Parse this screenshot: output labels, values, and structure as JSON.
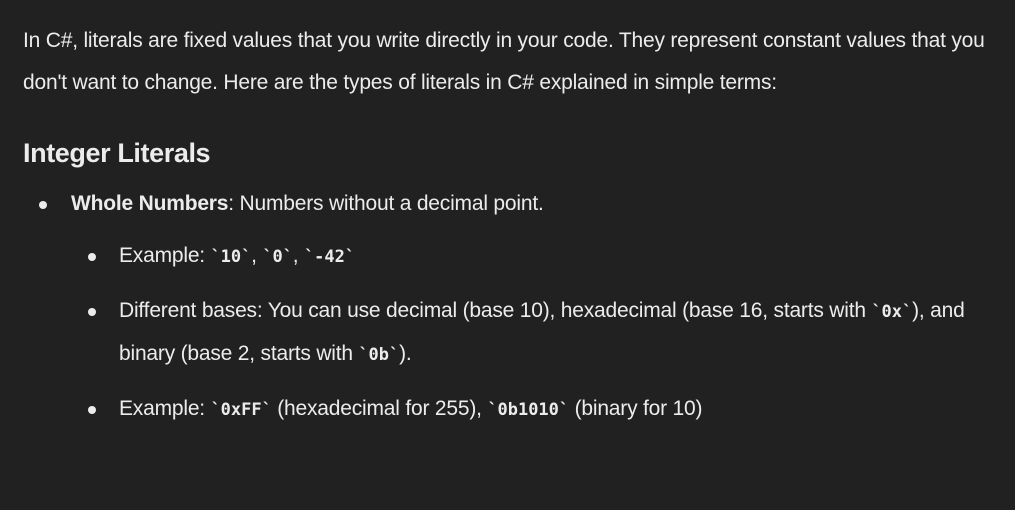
{
  "intro": "In C#, literals are fixed values that you write directly in your code. They represent constant values that you don't want to change. Here are the types of literals in C# explained in simple terms:",
  "section": {
    "heading": "Integer Literals",
    "item": {
      "term": "Whole Numbers",
      "desc": ": Numbers without a decimal point."
    },
    "subitems": {
      "example1": {
        "prefix": "Example: ",
        "code1": "10",
        "sep1": ", ",
        "code2": "0",
        "sep2": ", ",
        "code3": "-42"
      },
      "bases": {
        "text1": "Different bases: You can use decimal (base 10), hexadecimal (base 16, starts with ",
        "code1": "0x",
        "text2": "), and binary (base 2, starts with ",
        "code2": "0b",
        "text3": ")."
      },
      "example2": {
        "prefix": "Example: ",
        "code1": "0xFF",
        "text1": " (hexadecimal for 255), ",
        "code2": "0b1010",
        "text2": " (binary for 10)"
      }
    }
  },
  "colors": {
    "background": "#212121",
    "text": "#ececec"
  }
}
